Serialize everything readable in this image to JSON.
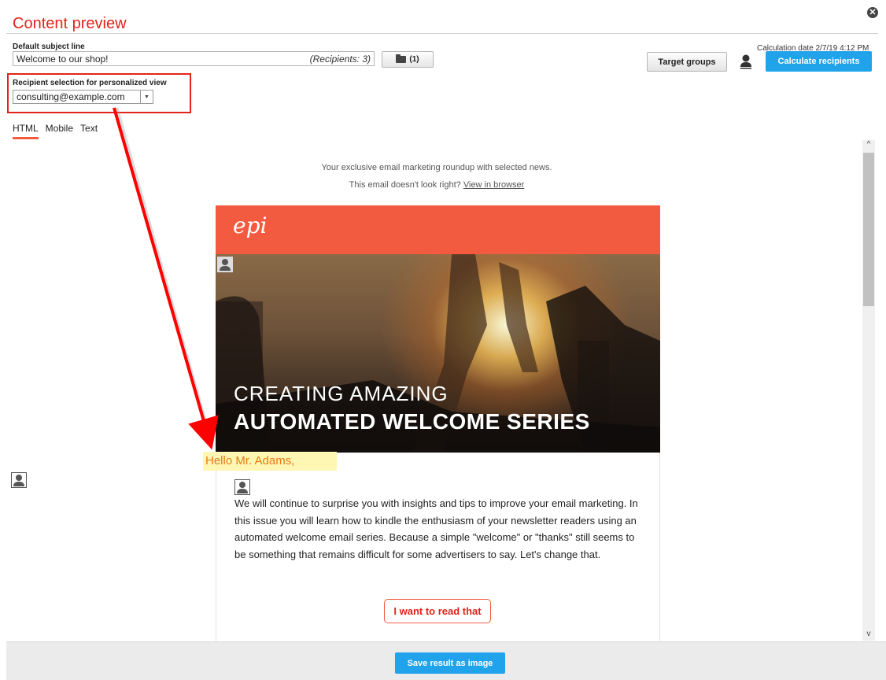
{
  "header": {
    "title": "Content preview",
    "close_label": "✕"
  },
  "subject": {
    "label": "Default subject line",
    "value": "Welcome to our shop!",
    "recipients": "(Recipients: 3)",
    "folder_count": "(1)"
  },
  "toolbar": {
    "calculation_date": "Calculation date 2/7/19 4:12 PM",
    "target_groups_label": "Target groups",
    "calculate_label": "Calculate recipients"
  },
  "recipient_selection": {
    "label": "Recipient selection for personalized view",
    "selected": "consulting@example.com"
  },
  "tabs": [
    {
      "label": "HTML",
      "active": true
    },
    {
      "label": "Mobile",
      "active": false
    },
    {
      "label": "Text",
      "active": false
    }
  ],
  "email": {
    "preheader": "Your exclusive email marketing roundup with selected news.",
    "view_prefix": "This email doesn't look right?",
    "view_link": "View in browser",
    "logo": "epi",
    "hero_line1": "CREATING AMAZING",
    "hero_line2": "AUTOMATED WELCOME SERIES",
    "greeting": "Hello Mr. Adams,",
    "body": "We will continue to surprise you with insights and tips to improve your email marketing. In this issue you will learn how to kindle the enthusiasm of your newsletter readers using an automated welcome email series. Because a simple \"welcome\" or \"thanks\" still seems to be something that remains difficult for some advertisers to say. Let's change that.",
    "cta": "I want to read that"
  },
  "footer": {
    "save_label": "Save result as image"
  },
  "colors": {
    "accent_red": "#e2231a",
    "brand_orange": "#f35b41",
    "button_blue": "#21a3ec",
    "greeting_highlight": "#fdf7b3"
  }
}
